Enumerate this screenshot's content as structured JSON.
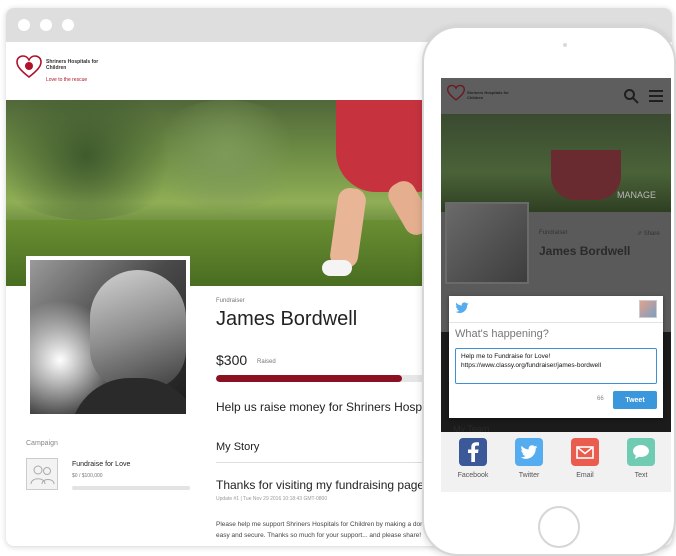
{
  "site": {
    "org_name": "Shriners Hospitals for Children",
    "tagline_logo": "Love to the rescue",
    "brand_color": "#8b1020"
  },
  "fundraiser": {
    "eyebrow": "Fundraiser",
    "name": "James Bordwell",
    "amount": "$300",
    "raised_label": "Raised",
    "progress_fraction": 0.81,
    "tagline": "Help us raise money for Shriners Hospitals for Children",
    "my_story": "My Story",
    "story_heading": "Thanks for visiting my fundraising page",
    "story_meta": "Update #1  |  Tue Nov 29 2016 10:18:43 GMT-0800",
    "story_body_1": "Please help me support Shriners Hospitals for Children by making a donation. It's",
    "story_body_2": "easy and secure. Thanks so much for your support... and please share!"
  },
  "campaign": {
    "label": "Campaign",
    "title": "Fundraise for Love",
    "goal": "$0 / $100,000"
  },
  "mobile": {
    "manage": "MANAGE",
    "eyebrow": "Fundraiser",
    "share": "Share",
    "name": "James Bordwell",
    "my_team": "My Team",
    "tweet": {
      "prompt": "What's happening?",
      "text": "Help me to Fundraise for Love!\nhttps://www.classy.org/fundraiser/james-bordwell",
      "count": "66",
      "button": "Tweet"
    },
    "share_options": [
      {
        "label": "Facebook",
        "icon": "facebook-icon",
        "color": "#3b5998"
      },
      {
        "label": "Twitter",
        "icon": "twitter-icon",
        "color": "#55acee"
      },
      {
        "label": "Email",
        "icon": "email-icon",
        "color": "#ea5c4e"
      },
      {
        "label": "Text",
        "icon": "text-bubble-icon",
        "color": "#6fcbb2"
      }
    ]
  }
}
